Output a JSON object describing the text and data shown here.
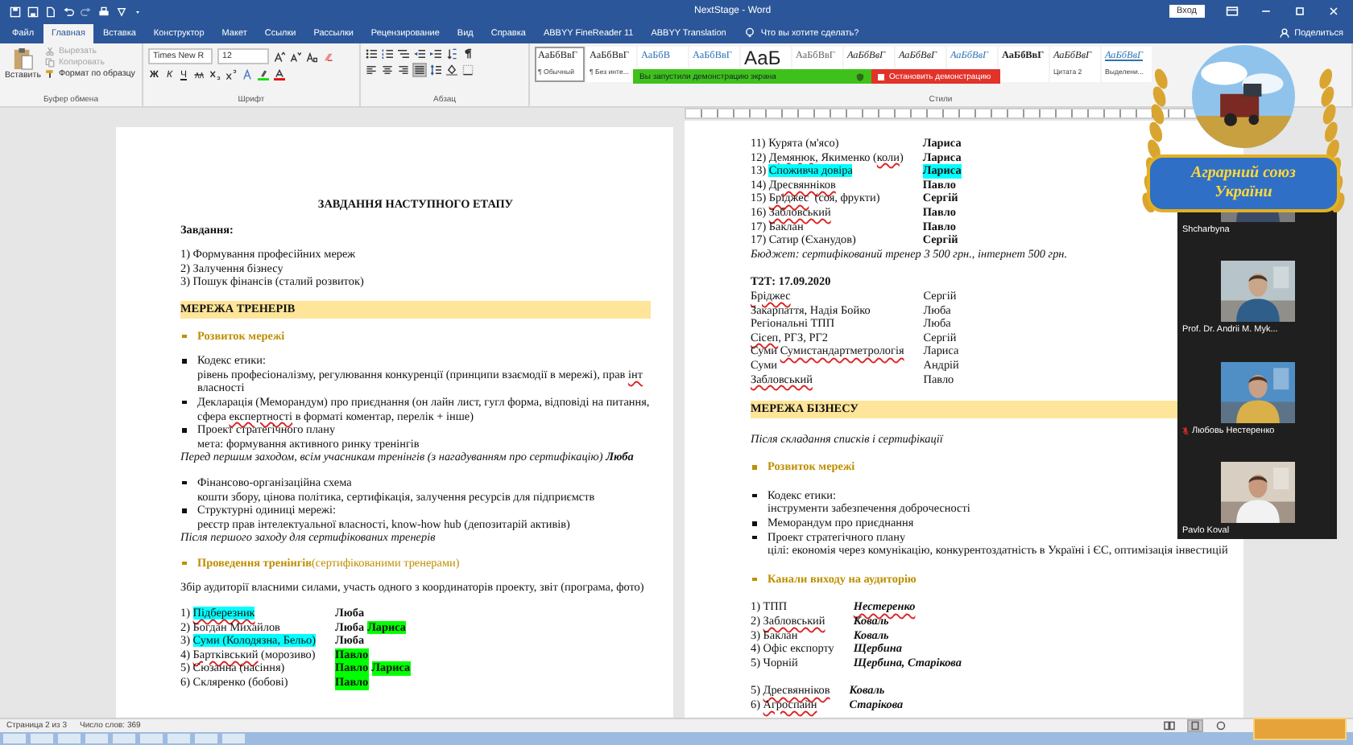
{
  "window": {
    "title": "NextStage - Word",
    "signin": "Вход",
    "tell_me": "Что вы хотите сделать?",
    "share": "Поделиться"
  },
  "tabs": [
    {
      "label": "Файл",
      "selected": false
    },
    {
      "label": "Главная",
      "selected": true
    },
    {
      "label": "Вставка",
      "selected": false
    },
    {
      "label": "Конструктор",
      "selected": false
    },
    {
      "label": "Макет",
      "selected": false
    },
    {
      "label": "Ссылки",
      "selected": false
    },
    {
      "label": "Рассылки",
      "selected": false
    },
    {
      "label": "Рецензирование",
      "selected": false
    },
    {
      "label": "Вид",
      "selected": false
    },
    {
      "label": "Справка",
      "selected": false
    },
    {
      "label": "ABBYY FineReader 11",
      "selected": false
    },
    {
      "label": "ABBYY Translation",
      "selected": false
    }
  ],
  "ribbon": {
    "clipboard": {
      "paste": "Вставить",
      "cut": {
        "label": "Вырезать",
        "disabled": true
      },
      "copy": {
        "label": "Копировать",
        "disabled": true
      },
      "format_painter": {
        "label": "Формат по образцу",
        "disabled": false
      },
      "label": "Буфер обмена"
    },
    "font": {
      "name": "Times New R",
      "size": "12",
      "format_buttons": [
        "Ж",
        "К",
        "Ч"
      ],
      "label": "Шрифт"
    },
    "paragraph": {
      "alignments": [
        {
          "kind": "left",
          "selected": false
        },
        {
          "kind": "center",
          "selected": false
        },
        {
          "kind": "right",
          "selected": false
        },
        {
          "kind": "justify",
          "selected": true
        }
      ],
      "label": "Абзац"
    },
    "styles": {
      "items": [
        {
          "sample": "АаБбВвГ",
          "name": "¶ Обычный",
          "kind": "normal",
          "selected": true
        },
        {
          "sample": "АаБбВвГ",
          "name": "¶ Без инте...",
          "kind": "normal",
          "selected": false
        },
        {
          "sample": "АаБбВ",
          "kind": "heading",
          "selected": false
        },
        {
          "sample": "АаБбВвГ",
          "kind": "heading",
          "selected": false
        },
        {
          "sample": "АаБ",
          "kind": "title",
          "selected": false
        },
        {
          "sample": "АаБбВвГ",
          "kind": "subtitle",
          "selected": false
        },
        {
          "sample": "АаБбВвГ",
          "kind": "emphasis",
          "selected": false
        },
        {
          "sample": "АаБбВвГ",
          "kind": "emphasis",
          "selected": false
        },
        {
          "sample": "АаБбВвГ",
          "kind": "intense",
          "selected": false
        },
        {
          "sample": "АаБбВвГ",
          "kind": "strong",
          "selected": false
        },
        {
          "sample": "АаБбВвГ",
          "name": "Цитата 2",
          "kind": "emphasis",
          "selected": false
        },
        {
          "sample": "АаБбВвГ",
          "name": "Выделени...",
          "kind": "reference",
          "selected": false
        }
      ],
      "label": "Стили"
    }
  },
  "screen_share": {
    "message": "Вы запустили демонстрацию экрана",
    "stop": "Остановить демонстрацию"
  },
  "pages": [
    {
      "groups": [
        [
          {
            "kind": "title",
            "text": "ЗАВДАННЯ НАСТУПНОГО ЕТАПУ"
          }
        ],
        [
          {
            "kind": "label",
            "text": "Завдання:"
          }
        ],
        [
          {
            "kind": "text",
            "runs": [
              {
                "text": "1) Формування професійних мереж"
              }
            ]
          },
          {
            "kind": "text",
            "runs": [
              {
                "text": "2) Залучення бізнесу"
              }
            ]
          },
          {
            "kind": "text",
            "runs": [
              {
                "text": "3) Пошук фінансів (сталий розвиток)"
              }
            ]
          }
        ],
        [
          {
            "kind": "band",
            "text": "МЕРЕЖА ТРЕНЕРІВ"
          }
        ],
        [
          {
            "kind": "topic",
            "title": "Розвиток мережі"
          }
        ],
        [
          {
            "kind": "bullet",
            "runs": [
              {
                "text": "Кодекс етики:"
              }
            ],
            "detail": [
              {
                "text": "рівень професіоналізму, регулювання конкуренції (принципи взаємодії в мережі), прав "
              },
              {
                "text": "інт",
                "misspelled": true
              },
              {
                "text": " власності"
              }
            ]
          },
          {
            "kind": "bullet",
            "runs": [
              {
                "text": "Декларація (Меморандум) про приєднання (он лайн лист, гугл форма, відповіді на питання, сфера "
              },
              {
                "text": "експертності",
                "misspelled": true
              },
              {
                "text": " в форматі коментар, перелік + інше)"
              }
            ]
          },
          {
            "kind": "bullet",
            "runs": [
              {
                "text": "Проект стратегічного плану"
              }
            ],
            "detail": [
              {
                "text": "мета: формування активного ринку тренінгів"
              }
            ]
          },
          {
            "kind": "note",
            "text": "Перед першим заходом, всім учасникам тренінгів (з нагадуванням про сертифікацію) **Люба**"
          }
        ],
        [
          {
            "kind": "bullet",
            "runs": [
              {
                "text": "Фінансово-організаційна схема"
              }
            ],
            "detail": [
              {
                "text": "кошти збору, цінова політика, сертифікація, залучення ресурсів для підприємств"
              }
            ]
          },
          {
            "kind": "bullet",
            "runs": [
              {
                "text": "Структурні одиниці мережі:"
              }
            ],
            "detail": [
              {
                "text": "реєстр прав інтелектуальної власності, know-how hub (депозитарій активів)"
              }
            ]
          },
          {
            "kind": "note",
            "text": "Після першого заходу для сертифікованих тренерів"
          }
        ],
        [
          {
            "kind": "topic",
            "title": "Проведення тренінгів",
            "note": "(сертифікованими тренерами)"
          }
        ],
        [
          {
            "kind": "text",
            "runs": [
              {
                "text": "Збір аудиторії власними силами, участь одного з координаторів проекту, звіт (програма, фото)"
              }
            ]
          }
        ],
        [
          {
            "kind": "assignment",
            "left": [
              {
                "text": "1) "
              },
              {
                "text": "Підберезник",
                "color": "#00ffff",
                "misspelled": true
              }
            ],
            "right": [
              {
                "text": "Люба"
              }
            ]
          },
          {
            "kind": "assignment",
            "left": [
              {
                "text": "2) Богдан Михайлов"
              }
            ],
            "right": [
              {
                "text": "Люба"
              },
              {
                "text": "Лариса",
                "color": "#00ff00"
              }
            ]
          },
          {
            "kind": "assignment",
            "left": [
              {
                "text": "3) "
              },
              {
                "text": "Суми (Колодязна, Бельо)",
                "color": "#00ffff"
              }
            ],
            "right": [
              {
                "text": "Люба"
              }
            ]
          },
          {
            "kind": "assignment",
            "left": [
              {
                "text": "4) "
              },
              {
                "text": "Бартківський",
                "misspelled": true
              },
              {
                "text": " (морозиво)"
              }
            ],
            "right": [
              {
                "text": "Павло",
                "color": "#00ff00"
              }
            ]
          },
          {
            "kind": "assignment",
            "left": [
              {
                "text": "5) Сюзанна (насіння)"
              }
            ],
            "right": [
              {
                "text": "Павло",
                "color": "#00ff00"
              },
              {
                "text": "Лариса",
                "color": "#00ff00"
              }
            ]
          },
          {
            "kind": "assignment",
            "left": [
              {
                "text": "6) Скляренко (бобові)"
              }
            ],
            "right": [
              {
                "text": "Павло",
                "color": "#00ff00"
              }
            ]
          }
        ]
      ]
    },
    {
      "groups": [
        [
          {
            "kind": "assignment",
            "left": [
              {
                "text": "11) Курята (м'ясо)"
              }
            ],
            "right": [
              {
                "text": "Лариса"
              }
            ]
          },
          {
            "kind": "assignment",
            "left": [
              {
                "text": "12) "
              },
              {
                "text": "Демянюк",
                "misspelled": true
              },
              {
                "text": ", Якименко ("
              },
              {
                "text": "коли",
                "misspelled": true
              },
              {
                "text": ")"
              }
            ],
            "right": [
              {
                "text": "Лариса"
              }
            ]
          },
          {
            "kind": "assignment",
            "left": [
              {
                "text": "13) "
              },
              {
                "text": "Споживча довіра",
                "color": "#00ffff"
              }
            ],
            "right": [
              {
                "text": "Лариса",
                "color": "#00ffff"
              }
            ]
          },
          {
            "kind": "assignment",
            "left": [
              {
                "text": "14) "
              },
              {
                "text": "Дресвянніков",
                "misspelled": true
              }
            ],
            "right": [
              {
                "text": "Павло"
              }
            ]
          },
          {
            "kind": "assignment",
            "left": [
              {
                "text": "15) "
              },
              {
                "text": "Бріджес",
                "misspelled": true
              },
              {
                "text": "  (соя, фрукти)"
              }
            ],
            "right": [
              {
                "text": "Сергій"
              }
            ]
          },
          {
            "kind": "assignment",
            "left": [
              {
                "text": "16) "
              },
              {
                "text": "Забловський",
                "misspelled": true
              }
            ],
            "right": [
              {
                "text": "Павло"
              }
            ]
          },
          {
            "kind": "assignment",
            "left": [
              {
                "text": "17) Баклан"
              }
            ],
            "right": [
              {
                "text": "Павло"
              }
            ]
          },
          {
            "kind": "assignment",
            "left": [
              {
                "text": "17) Сатир (Єханудов)"
              }
            ],
            "right": [
              {
                "text": "Сергій"
              }
            ]
          },
          {
            "kind": "note",
            "text": "Бюджет: сертифікований тренер 3 500 грн., інтернет 500 грн."
          }
        ],
        [
          {
            "kind": "label",
            "text": "Т2Т: 17.09.2020"
          },
          {
            "kind": "contact",
            "left": [
              {
                "text": "Бріджес",
                "misspelled": true
              }
            ],
            "right": [
              {
                "text": "Сергій"
              }
            ]
          },
          {
            "kind": "contact",
            "left": [
              {
                "text": "Закарпаття, Надія Бойко"
              }
            ],
            "right": [
              {
                "text": "Люба"
              }
            ]
          },
          {
            "kind": "contact",
            "left": [
              {
                "text": "Регіональні ТПП"
              }
            ],
            "right": [
              {
                "text": "Люба"
              }
            ]
          },
          {
            "kind": "contact",
            "left": [
              {
                "text": "Сісеп",
                "misspelled": true
              },
              {
                "text": ", РГЗ, РГ2"
              }
            ],
            "right": [
              {
                "text": "Сергій"
              }
            ]
          },
          {
            "kind": "contact",
            "left": [
              {
                "text": "Суми "
              },
              {
                "text": "Сумистандартметрологія",
                "misspelled": true
              }
            ],
            "right": [
              {
                "text": "Лариса"
              }
            ]
          },
          {
            "kind": "contact",
            "left": [
              {
                "text": "Суми"
              }
            ],
            "right": [
              {
                "text": "Андрій"
              }
            ]
          },
          {
            "kind": "contact",
            "left": [
              {
                "text": "Забловський",
                "misspelled": true
              }
            ],
            "right": [
              {
                "text": "Павло"
              }
            ]
          }
        ],
        [
          {
            "kind": "band",
            "text": "МЕРЕЖА БІЗНЕСУ"
          }
        ],
        [
          {
            "kind": "note",
            "text": "Після складання списків і сертифікації"
          }
        ],
        [
          {
            "kind": "topic",
            "title": "Розвиток мережі"
          }
        ],
        [
          {
            "kind": "bullet",
            "runs": [
              {
                "text": "Кодекс етики:"
              }
            ],
            "detail": [
              {
                "text": "інструменти забезпечення доброчесності"
              }
            ]
          },
          {
            "kind": "bullet",
            "runs": [
              {
                "text": "Меморандум про приєднання"
              }
            ]
          },
          {
            "kind": "bullet",
            "runs": [
              {
                "text": "Проект стратегічного плану"
              }
            ],
            "detail": [
              {
                "text": "цілі: економія через комунікацію, конкурентоздатність в Україні і ЄС, оптимізація інвестицій"
              }
            ]
          }
        ],
        [
          {
            "kind": "topic",
            "title": "Канали виходу на аудиторію"
          }
        ],
        [
          {
            "kind": "channel",
            "left": [
              {
                "text": "1) ТПП"
              }
            ],
            "right": [
              {
                "text": "Нестеренко",
                "misspelled": true
              }
            ]
          },
          {
            "kind": "channel",
            "left": [
              {
                "text": "2) "
              },
              {
                "text": "Забловський",
                "misspelled": true
              }
            ],
            "right": [
              {
                "text": "Коваль"
              }
            ]
          },
          {
            "kind": "channel",
            "left": [
              {
                "text": "3) Баклан"
              }
            ],
            "right": [
              {
                "text": "Коваль"
              }
            ]
          },
          {
            "kind": "channel",
            "left": [
              {
                "text": "4) Офіс експорту"
              }
            ],
            "right": [
              {
                "text": "Щербина"
              }
            ]
          },
          {
            "kind": "channel",
            "left": [
              {
                "text": "5) Чорній"
              }
            ],
            "right": [
              {
                "text": "Щербина, Старікова"
              }
            ]
          }
        ],
        [
          {
            "kind": "channel",
            "left": [
              {
                "text": "5) "
              },
              {
                "text": "Дресвянніков",
                "misspelled": true
              }
            ],
            "right": [
              {
                "text": "Коваль"
              }
            ]
          },
          {
            "kind": "channel",
            "left": [
              {
                "text": "6) "
              },
              {
                "text": "Агроспайн",
                "misspelled": true
              }
            ],
            "right": [
              {
                "text": "Старікова"
              }
            ]
          }
        ]
      ]
    }
  ],
  "video_panel": {
    "participants": [
      {
        "name": "Shcharbyna",
        "muted": false
      },
      {
        "name": "Prof. Dr. Andrii M. Myk...",
        "muted": false
      },
      {
        "name": "Любовь Нестеренко",
        "muted": true
      },
      {
        "name": "Pavlo Koval",
        "muted": false
      }
    ]
  },
  "logo": {
    "lines": [
      "Аграрний союз",
      "України"
    ]
  },
  "status_bar": {
    "page": "Страница 2 из 3",
    "words": "Число слов: 369"
  }
}
